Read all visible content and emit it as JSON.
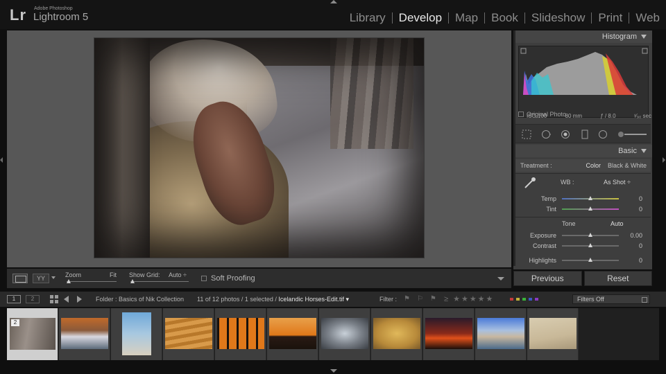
{
  "app": {
    "logo": "Lr",
    "vendor": "Adobe Photoshop",
    "title": "Lightroom 5"
  },
  "modules": [
    {
      "label": "Library",
      "active": false
    },
    {
      "label": "Develop",
      "active": true
    },
    {
      "label": "Map",
      "active": false
    },
    {
      "label": "Book",
      "active": false
    },
    {
      "label": "Slideshow",
      "active": false
    },
    {
      "label": "Print",
      "active": false
    },
    {
      "label": "Web",
      "active": false
    }
  ],
  "histogram": {
    "header": "Histogram",
    "iso": "ISO 100",
    "focal": "80 mm",
    "aperture": "ƒ / 8.0",
    "shutter": "¹⁄₉₀ sec",
    "original_photo": "Original Photo"
  },
  "basic": {
    "header": "Basic",
    "treatment_label": "Treatment :",
    "treatment_color": "Color",
    "treatment_bw": "Black & White",
    "wb_label": "WB :",
    "wb_value": "As Shot ÷",
    "temp": {
      "label": "Temp",
      "value": "0",
      "position": 0.5
    },
    "tint": {
      "label": "Tint",
      "value": "0",
      "position": 0.5
    },
    "tone_label": "Tone",
    "tone_auto": "Auto",
    "exposure": {
      "label": "Exposure",
      "value": "0.00",
      "position": 0.5
    },
    "contrast": {
      "label": "Contrast",
      "value": "0",
      "position": 0.5
    },
    "highlights": {
      "label": "Highlights",
      "value": "0",
      "position": 0.5
    }
  },
  "buttons": {
    "previous": "Previous",
    "reset": "Reset"
  },
  "toolbar": {
    "view_yy": "YY",
    "zoom_label": "Zoom",
    "fit_label": "Fit",
    "grid_label": "Show Grid:",
    "grid_value": "Auto ÷",
    "soft_proofing": "Soft Proofing"
  },
  "filmbar": {
    "screen1": "1",
    "screen2": "2",
    "folder": "Folder : Basics of Nik Collection",
    "count": "11 of 12 photos / 1 selected / ",
    "file": "Icelandic Horses-Edit.tif ▾",
    "filter_label": "Filter :",
    "stars": "≥ ★★★★★",
    "filters_off": "Filters Off",
    "selected_badge": "2"
  },
  "colors": {
    "accent_label_red": "#c23a3a",
    "accent_label_yellow": "#c2b23a",
    "accent_label_green": "#3ab23a",
    "accent_label_blue": "#3a5ac2",
    "accent_label_purple": "#8a3ac2"
  }
}
